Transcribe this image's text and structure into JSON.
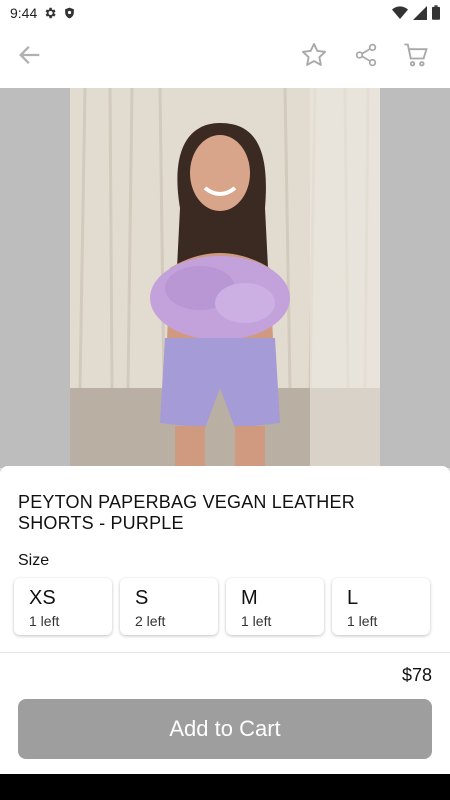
{
  "status_bar": {
    "time": "9:44"
  },
  "product": {
    "title": "PEYTON PAPERBAG VEGAN LEATHER SHORTS - PURPLE",
    "price": "$78"
  },
  "size_section": {
    "label": "Size"
  },
  "sizes": [
    {
      "name": "XS",
      "stock": "1 left"
    },
    {
      "name": "S",
      "stock": "2 left"
    },
    {
      "name": "M",
      "stock": "1 left"
    },
    {
      "name": "L",
      "stock": "1 left"
    }
  ],
  "actions": {
    "add_to_cart": "Add to Cart"
  },
  "colors": {
    "button_disabled": "#9e9e9e",
    "icon_gray": "#9e9e9e",
    "sheet": "#ffffff"
  },
  "icons": {
    "back": "arrow-left-icon",
    "favorite": "star-icon",
    "share": "share-icon",
    "cart": "cart-icon"
  }
}
